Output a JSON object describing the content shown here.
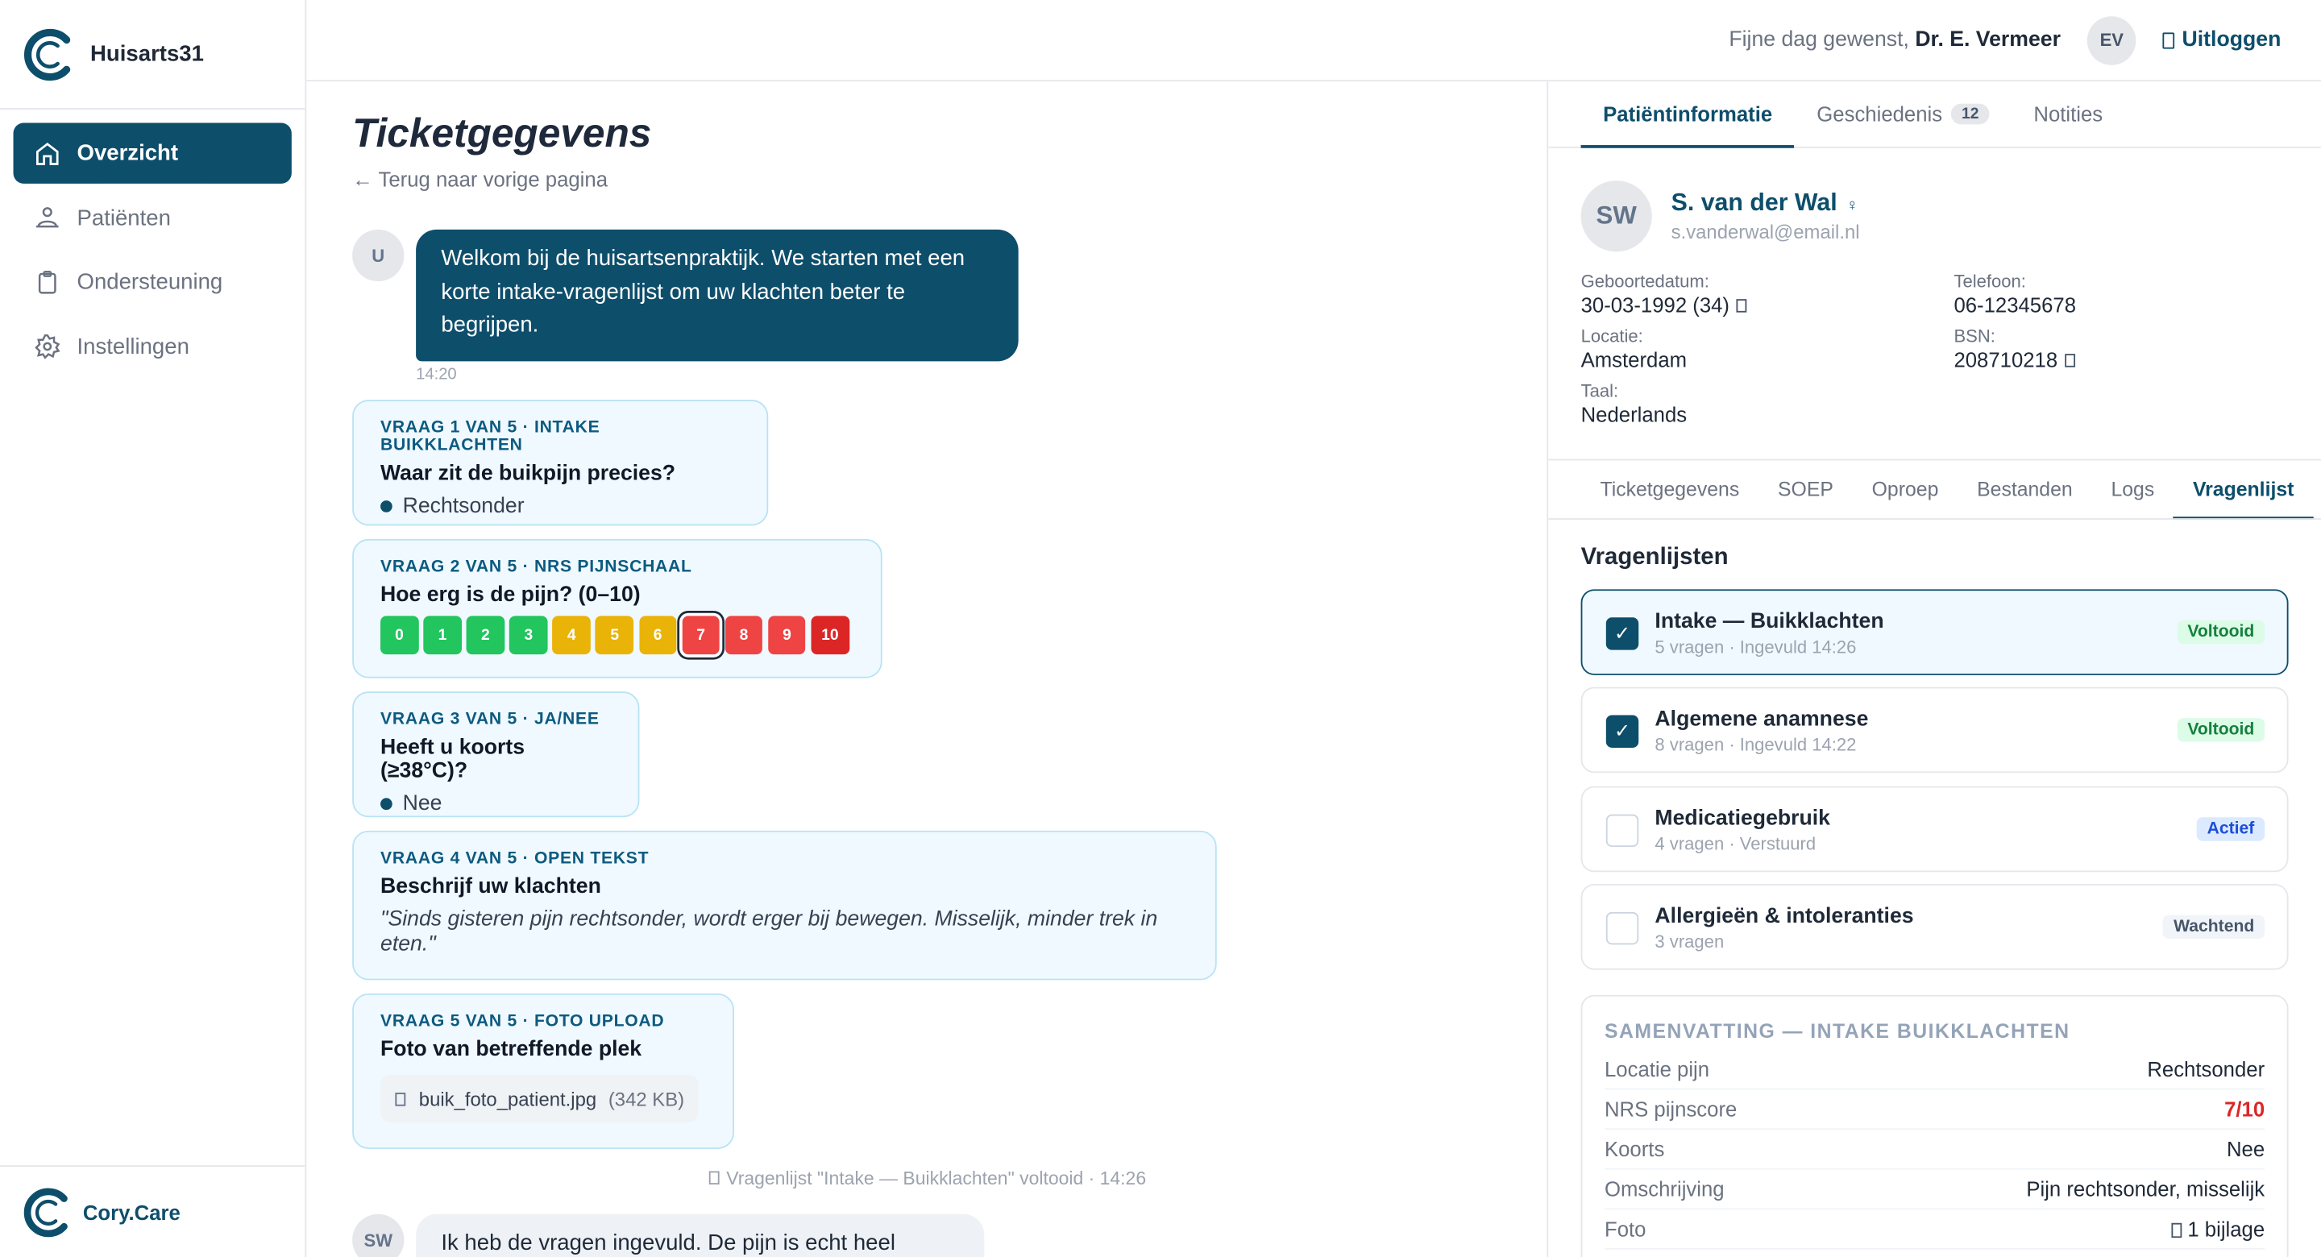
{
  "brand": {
    "name": "Huisarts31",
    "footer_name": "Cory.Care"
  },
  "nav": [
    {
      "label": "Overzicht",
      "icon": "home-icon",
      "active": true
    },
    {
      "label": "Patiënten",
      "icon": "users-icon",
      "active": false
    },
    {
      "label": "Ondersteuning",
      "icon": "clipboard-icon",
      "active": false
    },
    {
      "label": "Instellingen",
      "icon": "gear-icon",
      "active": false
    }
  ],
  "topbar": {
    "greeting": "Fijne dag gewenst, ",
    "user": "Dr. E. Vermeer",
    "avatar": "EV",
    "logout": "Uitloggen"
  },
  "main": {
    "title": "Ticketgegevens",
    "back": "← Terug naar vorige pagina",
    "welcome": {
      "avatar": "U",
      "text": "Welkom bij de huisartsenpraktijk. We starten met een korte intake-vragenlijst om uw klachten beter te begrijpen.",
      "time": "14:20"
    },
    "questions": {
      "q1": {
        "label": "VRAAG 1 VAN 5 · INTAKE BUIKKLACHTEN",
        "title": "Waar zit de buikpijn precies?",
        "answer": "Rechtsonder"
      },
      "q2": {
        "label": "VRAAG 2 VAN 5 · NRS PIJNSCHAAL",
        "title": "Hoe erg is de pijn? (0–10)",
        "scale": [
          "0",
          "1",
          "2",
          "3",
          "4",
          "5",
          "6",
          "7",
          "8",
          "9",
          "10"
        ],
        "scale_colors": [
          "#22c55e",
          "#22c55e",
          "#22c55e",
          "#22c55e",
          "#eab308",
          "#eab308",
          "#eab308",
          "#ef4444",
          "#ef4444",
          "#ef4444",
          "#dc2626"
        ],
        "selected": 7
      },
      "q3": {
        "label": "VRAAG 3 VAN 5 · JA/NEE",
        "title": "Heeft u koorts (≥38°C)?",
        "answer": "Nee"
      },
      "q4": {
        "label": "VRAAG 4 VAN 5 · OPEN TEKST",
        "title": "Beschrijf uw klachten",
        "answer": "\"Sinds gisteren pijn rechtsonder, wordt erger bij bewegen. Misselijk, minder trek in eten.\""
      },
      "q5": {
        "label": "VRAAG 5 VAN 5 · FOTO UPLOAD",
        "title": "Foto van betreffende plek",
        "file": "buik_foto_patient.jpg",
        "size": "(342 KB)"
      }
    },
    "system": "Vragenlijst \"Intake — Buikklachten\" voltooid · 14:26",
    "reply": {
      "avatar": "SW",
      "text": "Ik heb de vragen ingevuld. De pijn is echt heel"
    }
  },
  "right": {
    "tabs": [
      {
        "label": "Patiëntinformatie",
        "active": true
      },
      {
        "label": "Geschiedenis",
        "badge": "12"
      },
      {
        "label": "Notities"
      }
    ],
    "patient": {
      "initials": "SW",
      "name": "S. van der Wal",
      "gender": "♀",
      "email": "s.vanderwal@email.nl",
      "fields": {
        "dob_label": "Geboortedatum:",
        "dob": "30-03-1992 (34)",
        "phone_label": "Telefoon:",
        "phone": "06-12345678",
        "loc_label": "Locatie:",
        "loc": "Amsterdam",
        "bsn_label": "BSN:",
        "bsn": "208710218",
        "lang_label": "Taal:",
        "lang": "Nederlands"
      }
    },
    "tabs2": [
      "Ticketgegevens",
      "SOEP",
      "Oproep",
      "Bestanden",
      "Logs",
      "Vragenlijst"
    ],
    "vl_title": "Vragenlijsten",
    "lists": [
      {
        "title": "Intake — Buikklachten",
        "sub": "5 vragen · Ingevuld 14:26",
        "status": "Voltooid",
        "kind": "done",
        "checked": true,
        "selected": true
      },
      {
        "title": "Algemene anamnese",
        "sub": "8 vragen · Ingevuld 14:22",
        "status": "Voltooid",
        "kind": "done",
        "checked": true
      },
      {
        "title": "Medicatiegebruik",
        "sub": "4 vragen · Verstuurd",
        "status": "Actief",
        "kind": "act",
        "checked": false
      },
      {
        "title": "Allergieën & intoleranties",
        "sub": "3 vragen",
        "status": "Wachtend",
        "kind": "wait",
        "checked": false
      }
    ],
    "check": "✓",
    "summary": {
      "title": "SAMENVATTING — INTAKE BUIKKLACHTEN",
      "rows": [
        {
          "k": "Locatie pijn",
          "v": "Rechtsonder"
        },
        {
          "k": "NRS pijnscore",
          "v": "7/10"
        },
        {
          "k": "Koorts",
          "v": "Nee"
        },
        {
          "k": "Omschrijving",
          "v": "Pijn rechtsonder, misselijk"
        },
        {
          "k": "Foto",
          "v": "1 bijlage"
        }
      ]
    }
  }
}
